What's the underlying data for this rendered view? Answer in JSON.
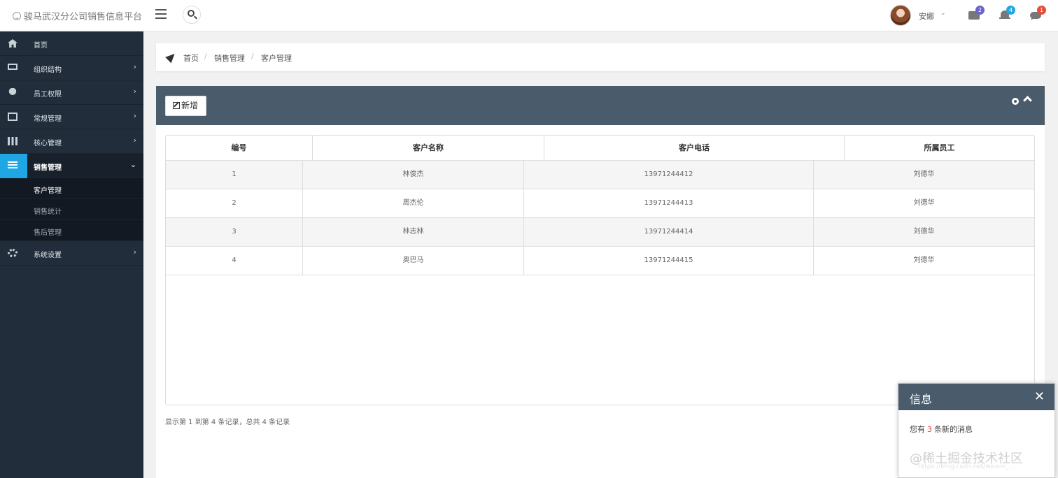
{
  "header": {
    "brand": "骏马武汉分公司销售信息平台",
    "user_name": "安娜",
    "mail_count": "2",
    "alert_count": "4",
    "chat_count": "1",
    "badge_colors": {
      "mail": "#6c63c9",
      "alert": "#1ea7e2",
      "chat": "#e74c3c"
    }
  },
  "sidebar": {
    "items": [
      {
        "label": "首页",
        "icon": "home-icon"
      },
      {
        "label": "组织结构",
        "icon": "desktop-icon"
      },
      {
        "label": "员工权限",
        "icon": "users-icon"
      },
      {
        "label": "常规管理",
        "icon": "credit-card-icon"
      },
      {
        "label": "核心管理",
        "icon": "bar-chart-icon"
      },
      {
        "label": "销售管理",
        "icon": "list-icon"
      },
      {
        "label": "系统设置",
        "icon": "gears-icon"
      }
    ],
    "submenu": [
      "客户管理",
      "销售统计",
      "售后管理"
    ],
    "accent": "#1ea7e2"
  },
  "breadcrumb": [
    "首页",
    "销售管理",
    "客户管理"
  ],
  "breadcrumb_sep": "/",
  "panel": {
    "add_label": "新增",
    "columns": [
      "编号",
      "客户名称",
      "客户电话",
      "所属员工"
    ],
    "rows": [
      [
        "1",
        "林俊杰",
        "13971244412",
        "刘德华"
      ],
      [
        "2",
        "周杰伦",
        "13971244413",
        "刘德华"
      ],
      [
        "3",
        "林志林",
        "13971244414",
        "刘德华"
      ],
      [
        "4",
        "奥巴马",
        "13971244415",
        "刘德华"
      ]
    ],
    "pager": "显示第 1 到第 4 条记录，总共 4 条记录"
  },
  "popup": {
    "title": "信息",
    "close": "✕",
    "msg_prefix": "您有",
    "msg_count": "3",
    "msg_suffix": "条新的消息"
  },
  "watermark": {
    "text": "@稀土掘金技术社区",
    "url": "https://blog.csdn.net/weixin_..."
  }
}
